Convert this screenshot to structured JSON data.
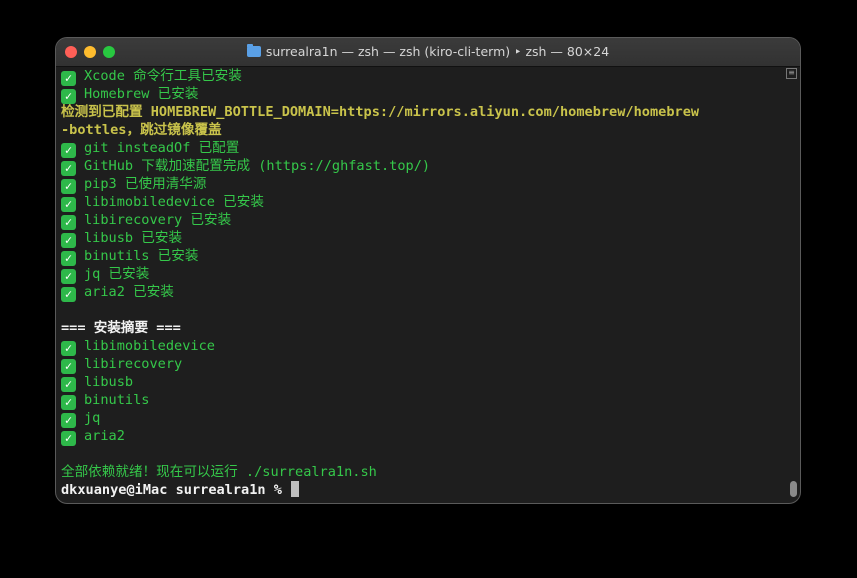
{
  "window": {
    "title": "surrealra1n — zsh — zsh (kiro-cli-term) ‣ zsh — 80×24"
  },
  "terminal": {
    "lines": [
      {
        "check": true,
        "cls": "g",
        "text": "Xcode 命令行工具已安装"
      },
      {
        "check": true,
        "cls": "g",
        "text": "Homebrew 已安装"
      },
      {
        "check": false,
        "cls": "y",
        "text": "检测到已配置 HOMEBREW_BOTTLE_DOMAIN=https://mirrors.aliyun.com/homebrew/homebrew"
      },
      {
        "check": false,
        "cls": "y",
        "text": "-bottles，跳过镜像覆盖"
      },
      {
        "check": true,
        "cls": "g",
        "text": "git insteadOf 已配置"
      },
      {
        "check": true,
        "cls": "g",
        "text": "GitHub 下载加速配置完成 (https://ghfast.top/)"
      },
      {
        "check": true,
        "cls": "g",
        "text": "pip3 已使用清华源"
      },
      {
        "check": true,
        "cls": "g",
        "text": "libimobiledevice 已安装"
      },
      {
        "check": true,
        "cls": "g",
        "text": "libirecovery 已安装"
      },
      {
        "check": true,
        "cls": "g",
        "text": "libusb 已安装"
      },
      {
        "check": true,
        "cls": "g",
        "text": "binutils 已安装"
      },
      {
        "check": true,
        "cls": "g",
        "text": "jq 已安装"
      },
      {
        "check": true,
        "cls": "g",
        "text": "aria2 已安装"
      },
      {
        "check": false,
        "cls": "g",
        "text": ""
      },
      {
        "check": false,
        "cls": "w",
        "text": "=== 安装摘要 ==="
      },
      {
        "check": true,
        "cls": "g",
        "text": "libimobiledevice"
      },
      {
        "check": true,
        "cls": "g",
        "text": "libirecovery"
      },
      {
        "check": true,
        "cls": "g",
        "text": "libusb"
      },
      {
        "check": true,
        "cls": "g",
        "text": "binutils"
      },
      {
        "check": true,
        "cls": "g",
        "text": "jq"
      },
      {
        "check": true,
        "cls": "g",
        "text": "aria2"
      },
      {
        "check": false,
        "cls": "g",
        "text": ""
      },
      {
        "check": false,
        "cls": "g",
        "text": "全部依赖就绪！现在可以运行 ./surrealra1n.sh"
      }
    ],
    "prompt": "dkxuanye@iMac surrealra1n % ",
    "check_glyph": "✓"
  },
  "colors": {
    "success": "#35c84a",
    "warning": "#c9c34b",
    "heading": "#f2f2f2",
    "background": "#1e1e1e"
  },
  "icons": {
    "check": "check-mark-icon",
    "folder": "folder-icon"
  }
}
